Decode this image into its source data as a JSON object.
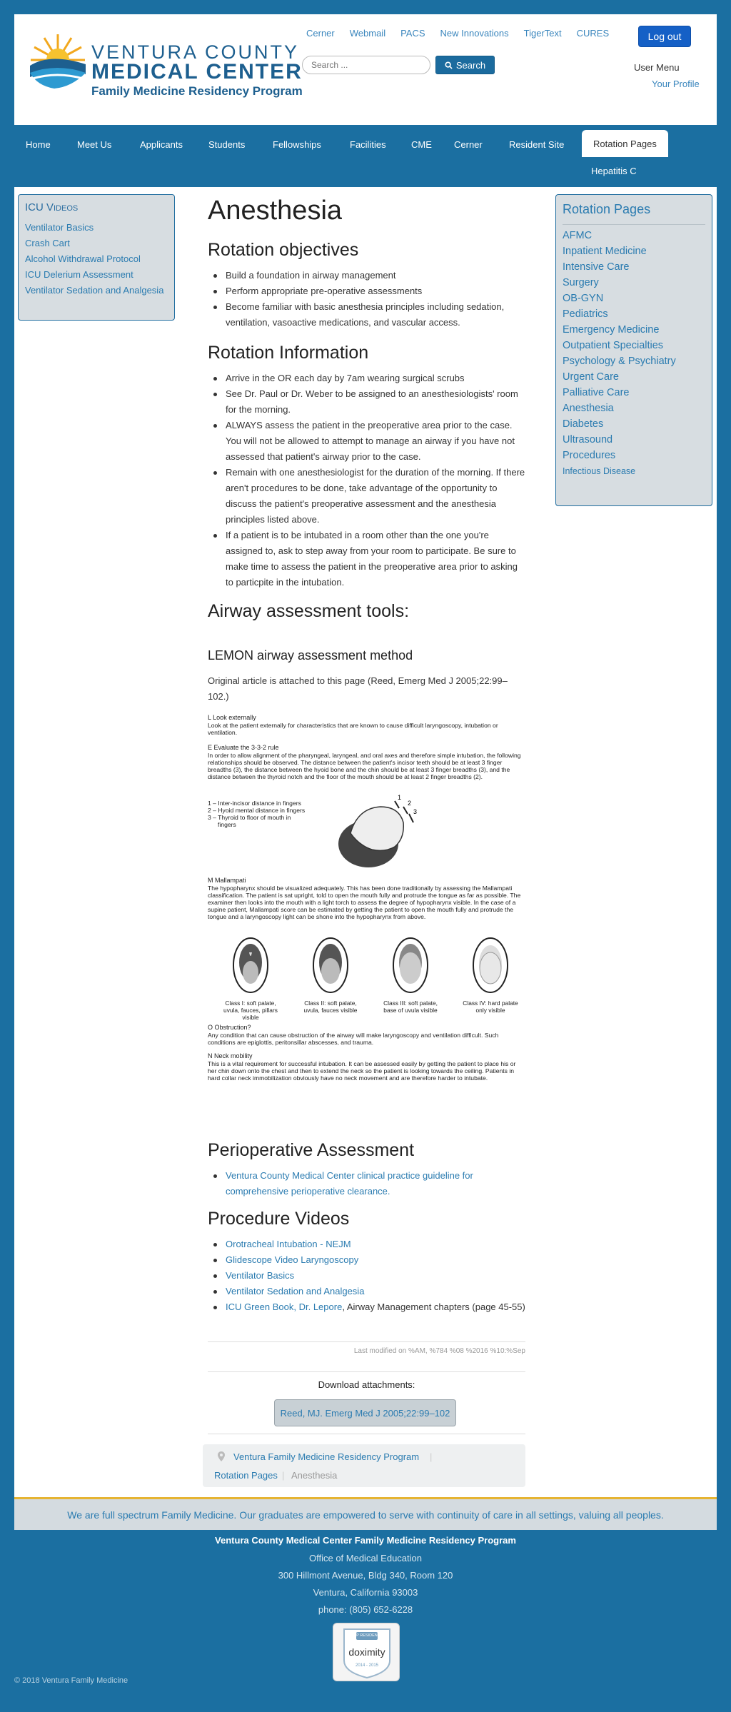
{
  "header": {
    "logo": {
      "line1": "VENTURA COUNTY",
      "line2": "MEDICAL CENTER",
      "line3": "Family Medicine Residency Program"
    },
    "top_links": [
      "Cerner",
      "Webmail",
      "PACS",
      "New Innovations",
      "TigerText",
      "CURES"
    ],
    "logout_label": "Log out",
    "search_placeholder": "Search ...",
    "search_label": "Search",
    "user_menu_label": "User Menu",
    "your_profile_label": "Your Profile"
  },
  "nav": {
    "items": [
      "Home",
      "Meet Us",
      "Applicants",
      "Students",
      "Fellowships",
      "Facilities",
      "CME",
      "Cerner",
      "Resident Site",
      "Rotation Pages"
    ],
    "active": "Rotation Pages",
    "sub_item": "Hepatitis C"
  },
  "left_sidebar": {
    "title": "ICU Videos",
    "items": [
      "Ventilator Basics",
      "Crash Cart",
      "Alcohol Withdrawal Protocol",
      "ICU Delerium Assessment",
      "Ventilator Sedation and Analgesia"
    ]
  },
  "content": {
    "title": "Anesthesia",
    "objectives_heading": "Rotation objectives",
    "objectives": [
      "Build a foundation in airway management",
      "Perform appropriate pre-operative assessments",
      "Become familiar with basic anesthesia principles including sedation, ventilation, vasoactive medications, and vascular access."
    ],
    "information_heading": "Rotation Information",
    "information": [
      "Arrive in the OR each day by 7am wearing surgical scrubs",
      "See Dr. Paul or Dr. Weber to be assigned to an anesthesiologists' room for the morning.",
      "ALWAYS assess the patient in the preoperative area prior to the case.  You will not be allowed to attempt to manage an airway if you have not assessed that patient's airway prior to the case.",
      "Remain with one anesthesiologist for the duration of the morning.  If there aren't procedures to be done, take advantage of the opportunity to discuss the patient's preoperative assessment and the anesthesia principles listed above.",
      "If a patient is to be intubated in a room other than the one you're assigned to, ask to step away from your room to participate.  Be sure to make time to assess the patient in the preoperative area prior to asking to particpite in the intubation."
    ],
    "airway_heading": "Airway assessment tools:",
    "lemon_heading": "LEMON airway assessment method",
    "lemon_note": "Original article is attached to this page (Reed, Emerg Med J 2005;22:99–102.)",
    "lemon": {
      "l_head": "L      Look externally",
      "l_text": "Look at the patient externally for characteristics that are known to cause difficult laryngoscopy, intubation or ventilation.",
      "e_head": "E      Evaluate the 3-3-2 rule",
      "e_text": "In order to allow alignment of the pharyngeal, laryngeal, and oral axes and therefore simple intubation, the following relationships should be observed. The distance between the patient's incisor teeth should be at least 3 finger breadths (3), the distance between the hyoid bone and the chin should be at least 3 finger breadths (3), and the distance between the thyroid notch and the floor of the mouth should be at least 2 finger breadths (2).",
      "e_list": [
        "1 – Inter-incisor distance in fingers",
        "2 – Hyoid mental distance in fingers",
        "3 – Thyroid to floor of mouth in",
        "fingers"
      ],
      "m_head": "M      Mallampati",
      "m_text": "The hypopharynx should be visualized adequately. This has been done traditionally by assessing the Mallampati classification. The patient is sat upright, told to open the mouth fully and protrude the tongue as far as possible. The examiner then looks into the mouth with a light torch to assess the degree of hypopharynx visible. In the case of a supine patient, Mallampati score can be estimated by getting the patient to open the mouth fully and protrude the tongue and a laryngoscopy light can be shone into the hypopharynx from above.",
      "classes": [
        "Class I: soft palate, uvula, fauces, pillars visible",
        "Class II: soft palate, uvula, fauces visible",
        "Class III: soft palate, base of uvula visible",
        "Class IV: hard palate only visible"
      ],
      "o_head": "O      Obstruction?",
      "o_text": "Any condition that can cause obstruction of the airway will make laryngoscopy and ventilation difficult. Such conditions are epiglottis, peritonsillar abscesses, and trauma.",
      "n_head": "N      Neck mobility",
      "n_text": "This is a vital requirement for successful intubation. It can be assessed easily by getting the patient to place his or her chin down onto the chest and then to extend the neck so the patient is looking towards the ceiling. Patients in hard collar neck immobilization obviously have no neck movement and are therefore harder to intubate."
    },
    "periop_heading": "Perioperative Assessment",
    "periop_link": "Ventura County Medical Center clinical practice guideline for comprehensive perioperative clearance.",
    "videos_heading": "Procedure Videos",
    "videos": [
      "Orotracheal Intubation - NEJM",
      "Glidescope Video Laryngoscopy",
      "Ventilator Basics",
      "Ventilator Sedation and Analgesia"
    ],
    "video_last_link": "ICU Green Book, Dr. Lepore",
    "video_last_text": ", Airway Management chapters (page 45-55)",
    "last_modified": "Last modified on %AM, %784 %08 %2016 %10:%Sep",
    "downloads_title": "Download attachments:",
    "attachment": "Reed, MJ. Emerg Med J 2005;22:99–102",
    "breadcrumb": [
      "Ventura Family Medicine Residency Program",
      "Rotation Pages",
      "Anesthesia"
    ]
  },
  "right_sidebar": {
    "title": "Rotation Pages",
    "items": [
      "AFMC",
      "Inpatient Medicine",
      "Intensive Care",
      "Surgery",
      "OB-GYN",
      "Pediatrics",
      "Emergency Medicine",
      "Outpatient Specialties",
      "Psychology & Psychiatry",
      "Urgent Care",
      "Palliative Care",
      "Anesthesia",
      "Diabetes",
      "Ultrasound",
      "Procedures",
      "Infectious Disease"
    ]
  },
  "footer": {
    "tagline": "We are full spectrum Family Medicine. Our graduates are empowered to serve with continuity of care in all settings, valuing all peoples.",
    "org": "Ventura County Medical Center Family Medicine Residency Program",
    "office": "Office of Medical Education",
    "address1": "300 Hillmont Avenue, Bldg 340, Room 120",
    "address2": "Ventura, California 93003",
    "phone": "phone: (805) 652-6228",
    "badge_top": "TOP RESIDENCY",
    "badge_name": "doximity",
    "badge_years": "2014 - 2015",
    "copyright": "© 2018 Ventura Family Medicine"
  },
  "colors": {
    "background": "#1b6fa1",
    "link": "#2a7bb0",
    "logout": "#1560c6",
    "sidebar_bg": "#d7dde1",
    "tagline_border": "#e6b432"
  }
}
